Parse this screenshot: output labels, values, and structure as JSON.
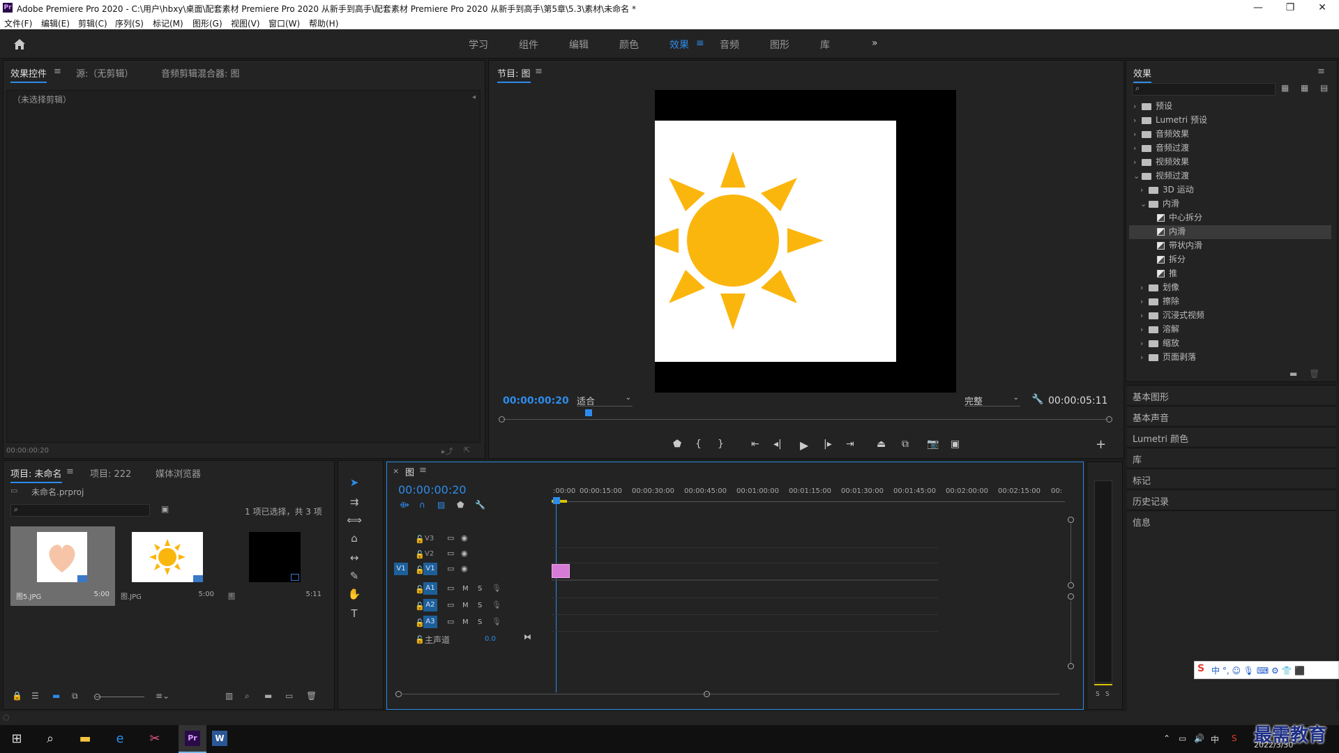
{
  "window": {
    "title": "Adobe Premiere Pro 2020 - C:\\用户\\hbxy\\桌面\\配套素材 Premiere Pro 2020 从新手到高手\\配套素材 Premiere Pro 2020 从新手到高手\\第5章\\5.3\\素材\\未命名 *",
    "logo": "Pr",
    "minimize": "—",
    "maximize": "❐",
    "close": "✕"
  },
  "menu": [
    "文件(F)",
    "编辑(E)",
    "剪辑(C)",
    "序列(S)",
    "标记(M)",
    "图形(G)",
    "视图(V)",
    "窗口(W)",
    "帮助(H)"
  ],
  "workspaces": {
    "items": [
      "学习",
      "组件",
      "编辑",
      "颜色",
      "效果",
      "音频",
      "图形",
      "库"
    ],
    "active": "效果",
    "more": "»",
    "menu_icon": "≡"
  },
  "effect_controls": {
    "tabs": [
      "效果控件",
      "源:（无剪辑）",
      "音频剪辑混合器: 图"
    ],
    "empty_text": "（未选择剪辑）",
    "timecode": "00:00:00:20"
  },
  "program_monitor": {
    "title": "节目: 图",
    "timecode": "00:00:00:20",
    "fit": "适合",
    "quality": "完整",
    "duration": "00:00:05:11"
  },
  "effects_panel": {
    "title": "效果",
    "search_placeholder": "",
    "tree": [
      {
        "label": "预设",
        "type": "folder",
        "level": 0,
        "expanded": false
      },
      {
        "label": "Lumetri 预设",
        "type": "folder",
        "level": 0,
        "expanded": false
      },
      {
        "label": "音频效果",
        "type": "folder",
        "level": 0,
        "expanded": false
      },
      {
        "label": "音频过渡",
        "type": "folder",
        "level": 0,
        "expanded": false
      },
      {
        "label": "视频效果",
        "type": "folder",
        "level": 0,
        "expanded": false
      },
      {
        "label": "视频过渡",
        "type": "folder",
        "level": 0,
        "expanded": true
      },
      {
        "label": "3D 运动",
        "type": "folder",
        "level": 1,
        "expanded": false
      },
      {
        "label": "内滑",
        "type": "folder",
        "level": 1,
        "expanded": true
      },
      {
        "label": "中心拆分",
        "type": "fx",
        "level": 2
      },
      {
        "label": "内滑",
        "type": "fx",
        "level": 2,
        "selected": true
      },
      {
        "label": "带状内滑",
        "type": "fx",
        "level": 2
      },
      {
        "label": "拆分",
        "type": "fx",
        "level": 2
      },
      {
        "label": "推",
        "type": "fx",
        "level": 2
      },
      {
        "label": "划像",
        "type": "folder",
        "level": 1,
        "expanded": false
      },
      {
        "label": "擦除",
        "type": "folder",
        "level": 1,
        "expanded": false
      },
      {
        "label": "沉浸式视频",
        "type": "folder",
        "level": 1,
        "expanded": false
      },
      {
        "label": "溶解",
        "type": "folder",
        "level": 1,
        "expanded": false
      },
      {
        "label": "缩放",
        "type": "folder",
        "level": 1,
        "expanded": false
      },
      {
        "label": "页面剥落",
        "type": "folder",
        "level": 1,
        "expanded": false
      }
    ],
    "sections": [
      "基本图形",
      "基本声音",
      "Lumetri 颜色",
      "库",
      "标记",
      "历史记录",
      "信息"
    ]
  },
  "project_panel": {
    "tabs": [
      "项目: 未命名",
      "项目: 222",
      "媒体浏览器"
    ],
    "project_file": "未命名.prproj",
    "selection_info": "1 项已选择，共 3 项",
    "items": [
      {
        "name": "图5.JPG",
        "duration": "5:00",
        "kind": "heart",
        "selected": true
      },
      {
        "name": "图.JPG",
        "duration": "5:00",
        "kind": "sun",
        "selected": false
      },
      {
        "name": "图",
        "duration": "5:11",
        "kind": "sequence",
        "selected": false
      }
    ]
  },
  "timeline": {
    "close": "×",
    "title": "图",
    "timecode": "00:00:00:20",
    "ruler": [
      ":00:00",
      "00:00:15:00",
      "00:00:30:00",
      "00:00:45:00",
      "00:01:00:00",
      "00:01:15:00",
      "00:01:30:00",
      "00:01:45:00",
      "00:02:00:00",
      "00:02:15:00",
      "00:"
    ],
    "video_tracks": [
      "V3",
      "V2",
      "V1"
    ],
    "audio_tracks": [
      "A1",
      "A2",
      "A3"
    ],
    "source_patch": "V1",
    "mute": "M",
    "solo": "S",
    "master_label": "主声道",
    "master_value": "0.0"
  },
  "audio_meter": {
    "s1": "S",
    "s2": "S"
  },
  "taskbar": {
    "date": "2022/3/30",
    "ime": "中 °, ☺ 🎙 ⌨ ⚙ 👕 ⬛",
    "watermark": "最需教育"
  },
  "colors": {
    "accent": "#2d8ceb",
    "panel": "#232323",
    "clip": "#d67bd6"
  }
}
